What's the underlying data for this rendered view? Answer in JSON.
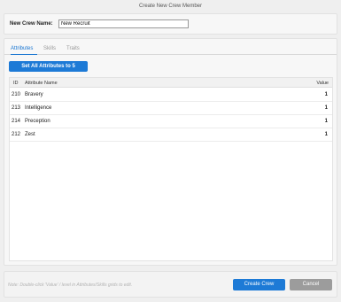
{
  "window": {
    "title": "Create New Crew Member"
  },
  "name_field": {
    "label": "New Crew Name:",
    "value": "New Recruit"
  },
  "tabs": [
    {
      "label": "Attributes",
      "active": true
    },
    {
      "label": "Skills",
      "active": false
    },
    {
      "label": "Traits",
      "active": false
    }
  ],
  "set_all_button": "Set All Attributes to 5",
  "table": {
    "headers": {
      "id": "ID",
      "name": "Attribute Name",
      "value": "Value"
    },
    "rows": [
      {
        "id": "210",
        "name": "Bravery",
        "value": "1"
      },
      {
        "id": "213",
        "name": "Intelligence",
        "value": "1"
      },
      {
        "id": "214",
        "name": "Preception",
        "value": "1"
      },
      {
        "id": "212",
        "name": "Zest",
        "value": "1"
      }
    ]
  },
  "footer": {
    "note": "Note: Double-click 'Value' / level in Attributes/Skills grids to edit.",
    "create_label": "Create Crew",
    "cancel_label": "Cancel"
  },
  "colors": {
    "accent": "#1d7ad6",
    "cancel": "#9c9c9c"
  }
}
